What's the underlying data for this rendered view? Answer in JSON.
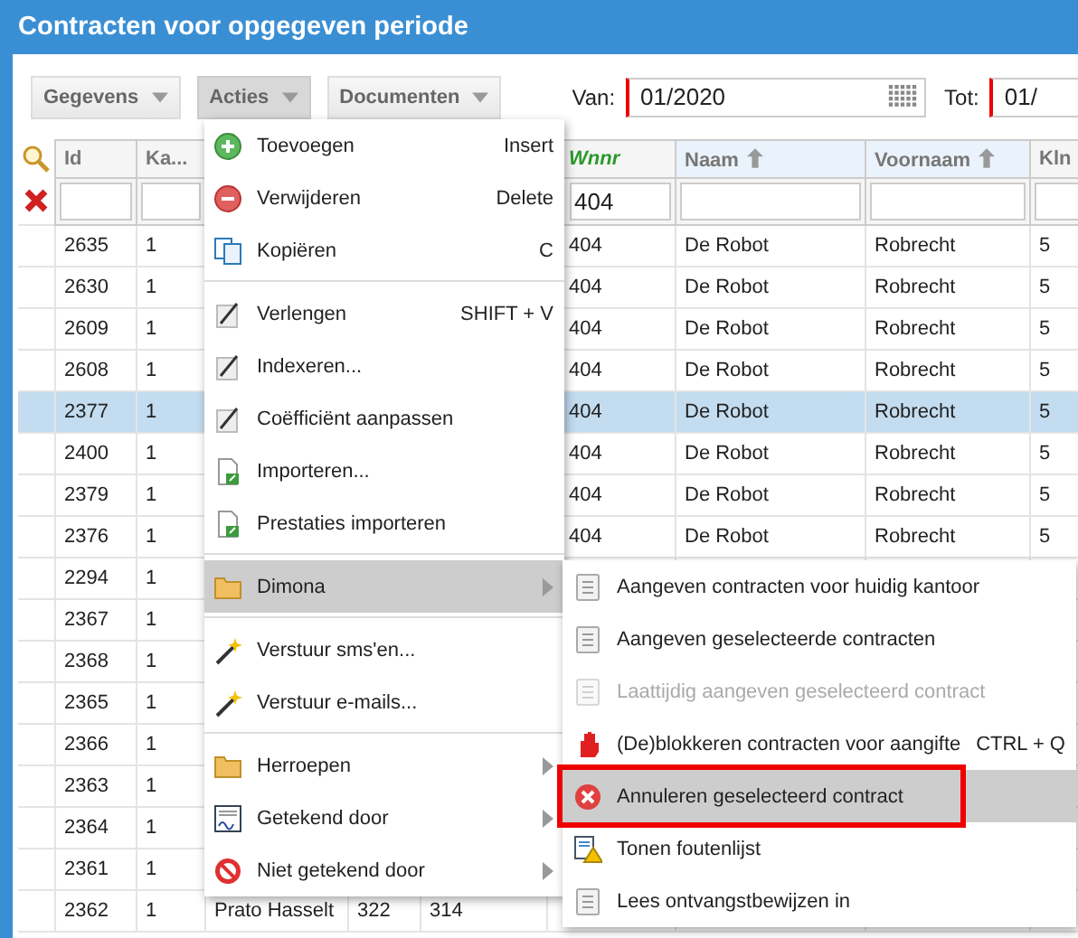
{
  "window": {
    "title": "Contracten voor opgegeven periode"
  },
  "toolbar": {
    "buttons": [
      {
        "label": "Gegevens",
        "selected": false
      },
      {
        "label": "Acties",
        "selected": true
      },
      {
        "label": "Documenten",
        "selected": false
      }
    ],
    "fields": [
      {
        "label": "Van:",
        "value": "01/2020",
        "required": true,
        "calendar": true
      },
      {
        "label": "Tot:",
        "value": "01/",
        "required": true,
        "calendar": false
      }
    ]
  },
  "table": {
    "columns": [
      {
        "label": "Id"
      },
      {
        "label": "Ka..."
      },
      null,
      null,
      null,
      {
        "label": "Wnnr",
        "filtered": true,
        "filter": "404"
      },
      {
        "label": "Naam",
        "sorted": true
      },
      {
        "label": "Voornaam",
        "sorted": true
      },
      {
        "label": "Kln"
      }
    ],
    "rows": [
      {
        "selected": false,
        "cells": [
          "2635",
          "1",
          null,
          null,
          null,
          "404",
          "De Robot",
          "Robrecht",
          "5"
        ]
      },
      {
        "selected": false,
        "cells": [
          "2630",
          "1",
          null,
          null,
          null,
          "404",
          "De Robot",
          "Robrecht",
          "5"
        ]
      },
      {
        "selected": false,
        "cells": [
          "2609",
          "1",
          null,
          null,
          null,
          "404",
          "De Robot",
          "Robrecht",
          "5"
        ]
      },
      {
        "selected": false,
        "cells": [
          "2608",
          "1",
          null,
          null,
          null,
          "404",
          "De Robot",
          "Robrecht",
          "5"
        ]
      },
      {
        "selected": true,
        "cells": [
          "2377",
          "1",
          null,
          null,
          null,
          "404",
          "De Robot",
          "Robrecht",
          "5"
        ]
      },
      {
        "selected": false,
        "cells": [
          "2400",
          "1",
          null,
          null,
          null,
          "404",
          "De Robot",
          "Robrecht",
          "5"
        ]
      },
      {
        "selected": false,
        "cells": [
          "2379",
          "1",
          null,
          null,
          null,
          "404",
          "De Robot",
          "Robrecht",
          "5"
        ]
      },
      {
        "selected": false,
        "cells": [
          "2376",
          "1",
          null,
          null,
          null,
          "404",
          "De Robot",
          "Robrecht",
          "5"
        ]
      },
      {
        "selected": false,
        "cells": [
          "2294",
          "1",
          null,
          null,
          null,
          null,
          null,
          null,
          null
        ]
      },
      {
        "selected": false,
        "cells": [
          "2367",
          "1",
          null,
          null,
          null,
          null,
          null,
          null,
          null
        ]
      },
      {
        "selected": false,
        "cells": [
          "2368",
          "1",
          null,
          null,
          null,
          null,
          null,
          null,
          null
        ]
      },
      {
        "selected": false,
        "cells": [
          "2365",
          "1",
          null,
          null,
          null,
          null,
          null,
          null,
          null
        ]
      },
      {
        "selected": false,
        "cells": [
          "2366",
          "1",
          null,
          null,
          null,
          null,
          null,
          null,
          null
        ]
      },
      {
        "selected": false,
        "cells": [
          "2363",
          "1",
          null,
          null,
          null,
          null,
          null,
          null,
          null
        ]
      },
      {
        "selected": false,
        "cells": [
          "2364",
          "1",
          null,
          null,
          null,
          null,
          null,
          null,
          null
        ]
      },
      {
        "selected": false,
        "cells": [
          "2361",
          "1",
          null,
          null,
          null,
          null,
          null,
          null,
          null
        ]
      },
      {
        "selected": false,
        "cells": [
          "2362",
          "1",
          "Prato Hasselt",
          "322",
          "314",
          null,
          null,
          null,
          null
        ]
      }
    ]
  },
  "menu": {
    "items": [
      {
        "kind": "item",
        "label": "Toevoegen",
        "shortcut": "Insert",
        "submenu": false,
        "selected": false
      },
      {
        "kind": "item",
        "label": "Verwijderen",
        "shortcut": "Delete",
        "submenu": false,
        "selected": false
      },
      {
        "kind": "item",
        "label": "Kopiëren",
        "shortcut": "C",
        "submenu": false,
        "selected": false
      },
      {
        "kind": "separator"
      },
      {
        "kind": "item",
        "label": "Verlengen",
        "shortcut": "SHIFT + V",
        "submenu": false,
        "selected": false
      },
      {
        "kind": "item",
        "label": "Indexeren...",
        "submenu": false,
        "selected": false
      },
      {
        "kind": "item",
        "label": "Coëfficiënt aanpassen",
        "submenu": false,
        "selected": false
      },
      {
        "kind": "item",
        "label": "Importeren...",
        "submenu": false,
        "selected": false
      },
      {
        "kind": "item",
        "label": "Prestaties importeren",
        "submenu": false,
        "selected": false
      },
      {
        "kind": "separator"
      },
      {
        "kind": "item",
        "label": "Dimona",
        "submenu": true,
        "selected": true
      },
      {
        "kind": "separator"
      },
      {
        "kind": "item",
        "label": "Verstuur sms'en...",
        "submenu": false,
        "selected": false
      },
      {
        "kind": "item",
        "label": "Verstuur e-mails...",
        "submenu": false,
        "selected": false
      },
      {
        "kind": "separator"
      },
      {
        "kind": "item",
        "label": "Herroepen",
        "submenu": true,
        "selected": false
      },
      {
        "kind": "item",
        "label": "Getekend door",
        "submenu": true,
        "selected": false
      },
      {
        "kind": "item",
        "label": "Niet getekend door",
        "submenu": true,
        "selected": false
      }
    ]
  },
  "submenu": {
    "items": [
      {
        "label": "Aangeven contracten voor huidig kantoor",
        "disabled": false,
        "selected": false,
        "outlined": false
      },
      {
        "label": "Aangeven geselecteerde contracten",
        "disabled": false,
        "selected": false,
        "outlined": false
      },
      {
        "label": "Laattijdig aangeven geselecteerd contract",
        "disabled": true,
        "selected": false,
        "outlined": false
      },
      {
        "label": "(De)blokkeren contracten voor aangifte",
        "shortcut": "CTRL + Q",
        "disabled": false,
        "selected": false,
        "outlined": false
      },
      {
        "label": "Annuleren geselecteerd contract",
        "disabled": false,
        "selected": true,
        "outlined": true
      },
      {
        "label": "Tonen foutenlijst",
        "disabled": false,
        "selected": false,
        "outlined": false
      },
      {
        "label": "Lees ontvangstbewijzen in",
        "disabled": false,
        "selected": false,
        "outlined": false
      }
    ]
  }
}
